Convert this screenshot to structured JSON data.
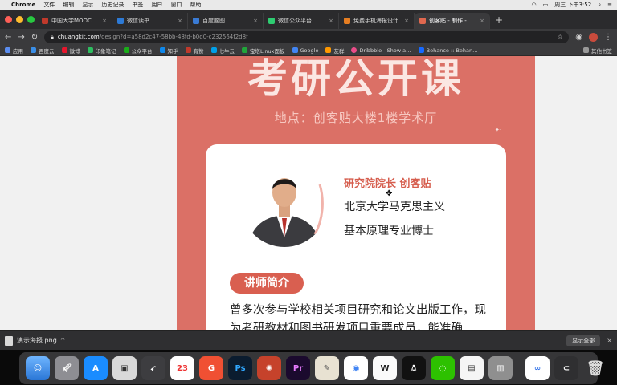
{
  "menubar": {
    "app": "Chrome",
    "menus": [
      "文件",
      "编辑",
      "显示",
      "历史记录",
      "书签",
      "用户",
      "窗口",
      "帮助"
    ],
    "clock": "周三 下午3:52"
  },
  "tabs": [
    {
      "title": "中国大学MOOC"
    },
    {
      "title": "微信读书"
    },
    {
      "title": "百度脑图"
    },
    {
      "title": "微信公众平台"
    },
    {
      "title": "免费手机海报设计"
    },
    {
      "title": "创客贴 - 制作 - 设计共"
    }
  ],
  "toolbar": {
    "url_host": "chuangkit.com",
    "url_path": "/design?d=a58d2c47-58bb-48fd-b0d0-c232564f2d8f"
  },
  "bookmarks": {
    "items": [
      "应用",
      "百度云",
      "微博",
      "印象笔记",
      "公众平台",
      "知乎",
      "有赞",
      "七牛云",
      "宝塔Linux面板",
      "Google",
      "友群",
      "Dribbble - Show a…",
      "Behance :: Behan…"
    ],
    "other": "其他书签"
  },
  "poster": {
    "title": "考研公开课",
    "location": "地点：创客贴大楼1楼学术厅",
    "role": "研究院院长  创客贴",
    "line1": "北京大学马克思主义",
    "line2": "基本原理专业博士",
    "intro_label": "讲师简介",
    "bio": "曾多次参与学校相关项目研究和论文出版工作，现为考研教材和图书研发项目重要成员，能准确"
  },
  "download": {
    "file": "演示海报.png",
    "show_all": "显示全部"
  },
  "dock": {
    "apps": [
      "Finder",
      "Launchpad",
      "App Store",
      "Preview",
      "Rocket",
      "Calendar",
      "Git",
      "Photoshop",
      "DaVinci",
      "Premiere",
      "Script",
      "Chrome",
      "Word",
      "QQ",
      "WeChat",
      "Books",
      "Keynote",
      "Baidu",
      "Scrollbar",
      "Trash"
    ],
    "calendar_day": "23"
  },
  "colors": {
    "poster": "#db7066",
    "accent": "#d95f50",
    "page_bg": "#f1f1f1"
  }
}
